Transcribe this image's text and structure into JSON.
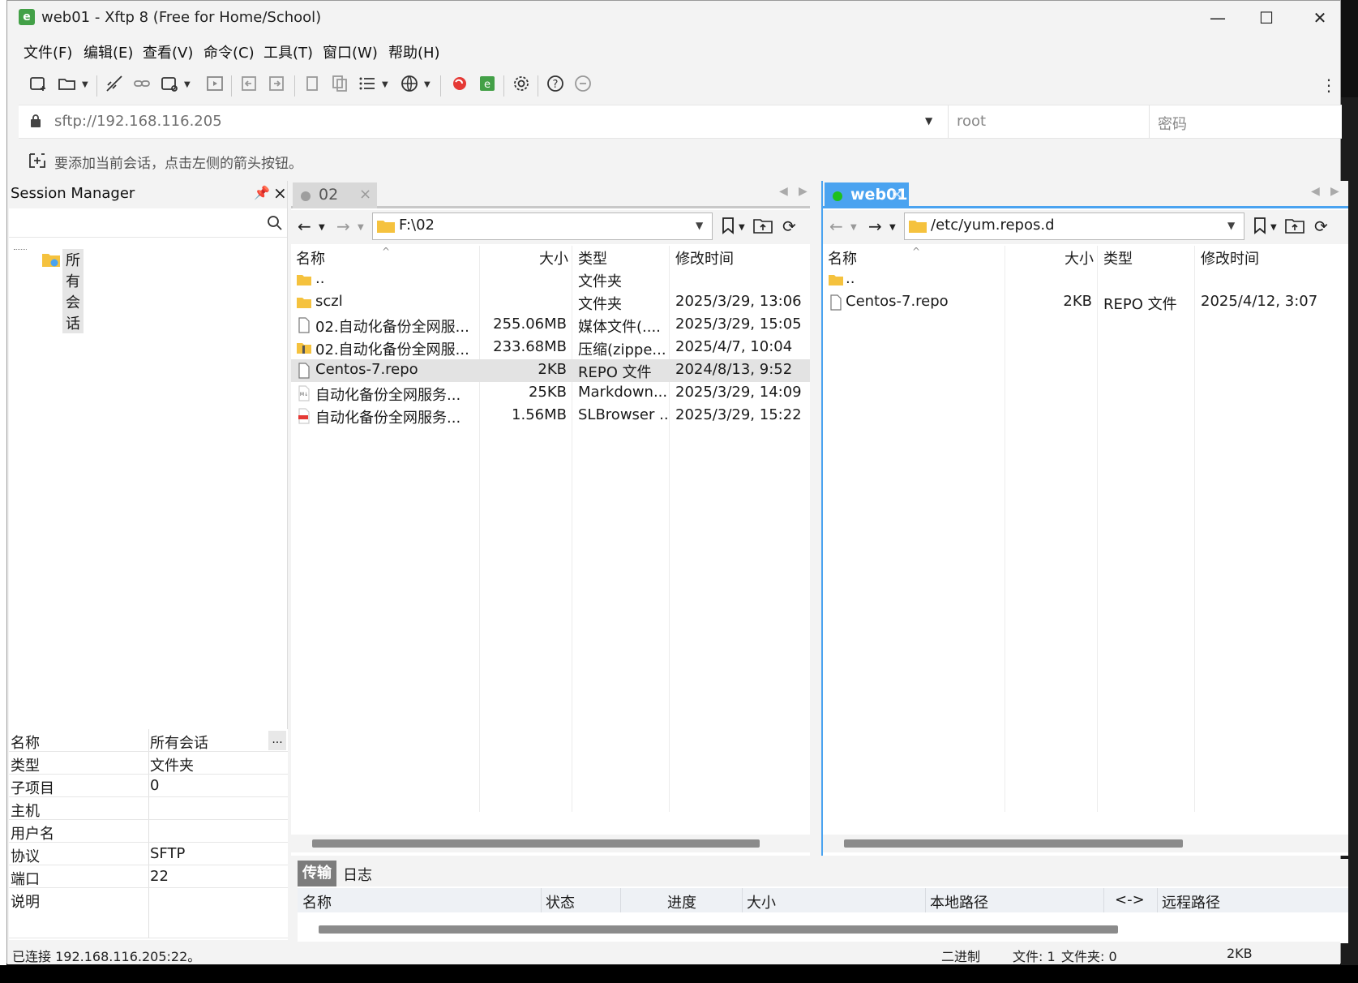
{
  "window": {
    "title": "web01 - Xftp 8 (Free for Home/School)"
  },
  "menu": [
    "文件(F)",
    "编辑(E)",
    "查看(V)",
    "命令(C)",
    "工具(T)",
    "窗口(W)",
    "帮助(H)"
  ],
  "address": {
    "url": "sftp://192.168.116.205",
    "username": "root",
    "password_placeholder": "密码"
  },
  "hint": "要添加当前会话，点击左侧的箭头按钮。",
  "session_manager": {
    "title": "Session Manager",
    "tree_root": "所有会话",
    "properties": [
      {
        "key": "名称",
        "value": "所有会话"
      },
      {
        "key": "类型",
        "value": "文件夹"
      },
      {
        "key": "子项目",
        "value": "0"
      },
      {
        "key": "主机",
        "value": ""
      },
      {
        "key": "用户名",
        "value": ""
      },
      {
        "key": "协议",
        "value": "SFTP"
      },
      {
        "key": "端口",
        "value": "22"
      },
      {
        "key": "说明",
        "value": ""
      }
    ],
    "more_button": "..."
  },
  "local": {
    "tab": "02",
    "path": "F:\\02",
    "columns": [
      "名称",
      "大小",
      "类型",
      "修改时间"
    ],
    "files": [
      {
        "name": "..",
        "size": "",
        "type": "文件夹",
        "modified": "",
        "icon": "folder"
      },
      {
        "name": "sczl",
        "size": "",
        "type": "文件夹",
        "modified": "2025/3/29, 13:06",
        "icon": "folder"
      },
      {
        "name": "02.自动化备份全网服...",
        "size": "255.06MB",
        "type": "媒体文件(....",
        "modified": "2025/3/29, 15:05",
        "icon": "file"
      },
      {
        "name": "02.自动化备份全网服...",
        "size": "233.68MB",
        "type": "压缩(zippe...",
        "modified": "2025/4/7, 10:04",
        "icon": "zip"
      },
      {
        "name": "Centos-7.repo",
        "size": "2KB",
        "type": "REPO 文件",
        "modified": "2024/8/13, 9:52",
        "icon": "file",
        "selected": true
      },
      {
        "name": "自动化备份全网服务...",
        "size": "25KB",
        "type": "Markdown...",
        "modified": "2025/3/29, 14:09",
        "icon": "md"
      },
      {
        "name": "自动化备份全网服务...",
        "size": "1.56MB",
        "type": "SLBrowser ...",
        "modified": "2025/3/29, 15:22",
        "icon": "pdf"
      }
    ]
  },
  "remote": {
    "tab": "web01",
    "path": "/etc/yum.repos.d",
    "columns": [
      "名称",
      "大小",
      "类型",
      "修改时间"
    ],
    "files": [
      {
        "name": "..",
        "size": "",
        "type": "",
        "modified": "",
        "icon": "folder"
      },
      {
        "name": "Centos-7.repo",
        "size": "2KB",
        "type": "REPO 文件",
        "modified": "2025/4/12, 3:07",
        "icon": "file"
      }
    ]
  },
  "transfer": {
    "tabs": [
      "传输",
      "日志"
    ],
    "columns": [
      "名称",
      "状态",
      "进度",
      "大小",
      "本地路径",
      "<->",
      "远程路径"
    ]
  },
  "status": {
    "connection": "已连接 192.168.116.205:22。",
    "mode": "二进制",
    "files": "文件: 1",
    "folders": "文件夹: 0",
    "size": "2KB"
  },
  "colors": {
    "accent": "#4aa3f0",
    "folder": "#f5c23e",
    "connected": "#1ec01e"
  }
}
